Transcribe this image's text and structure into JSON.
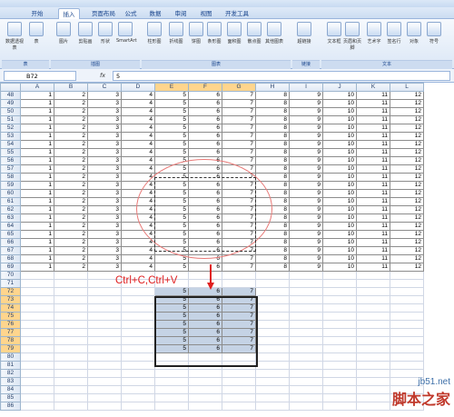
{
  "tabs": [
    "开始",
    "插入",
    "页面布局",
    "公式",
    "数据",
    "审阅",
    "视图",
    "开发工具"
  ],
  "active_tab": "插入",
  "ribbon": {
    "buttons": [
      "数据透视表",
      "表",
      "图片",
      "剪贴画",
      "形状",
      "SmartArt",
      "柱形图",
      "折线图",
      "饼图",
      "条形图",
      "面积图",
      "散点图",
      "其他图表",
      "超链接",
      "文本框",
      "页眉和页脚",
      "艺术字",
      "签名行",
      "对象",
      "符号"
    ],
    "groups": [
      "表",
      "插图",
      "图表",
      "链接",
      "文本"
    ]
  },
  "formula_bar": {
    "name_box": "B72",
    "fx": "fx",
    "value": "5"
  },
  "columns": [
    "A",
    "B",
    "C",
    "D",
    "E",
    "F",
    "G",
    "H",
    "I",
    "J",
    "K",
    "L"
  ],
  "copied_rows": {
    "start": 48,
    "end": 69,
    "values": [
      1,
      2,
      3,
      4,
      5,
      6,
      7,
      8,
      9,
      10,
      11,
      12
    ]
  },
  "empty_rows": [
    70,
    71
  ],
  "pasted_rows": {
    "start": 72,
    "end": 79,
    "values": [
      5,
      6,
      7
    ]
  },
  "trailing_rows": [
    80,
    81,
    82,
    83,
    84,
    85,
    86
  ],
  "annotation": "Ctrl+C,Ctrl+V",
  "watermark": {
    "line1": "jb51.net",
    "line2": "脚本之家"
  },
  "colors": {
    "annotation": "#e02020",
    "ellipse": "#e87a78",
    "selection_header": "#ffd58d",
    "paste_fill": "#c5d3e5"
  }
}
